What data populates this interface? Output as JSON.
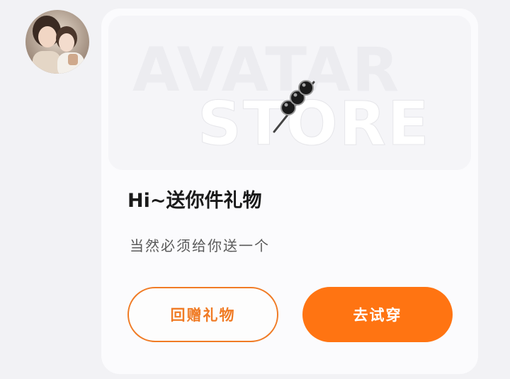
{
  "avatar": {
    "icon": "user-avatar-photo"
  },
  "banner": {
    "watermark_line1": "AVATAR",
    "watermark_line2": "STORE",
    "item_icon": "candy-skewer-icon"
  },
  "card": {
    "title": "Hi~送你件礼物",
    "subtitle": "当然必须给你送一个"
  },
  "actions": {
    "gift_back_label": "回赠礼物",
    "try_on_label": "去试穿"
  },
  "colors": {
    "accent": "#ff7412",
    "accent_outline": "#f07b25",
    "card_bg": "#fbfbfd",
    "page_bg": "#f2f2f5"
  }
}
